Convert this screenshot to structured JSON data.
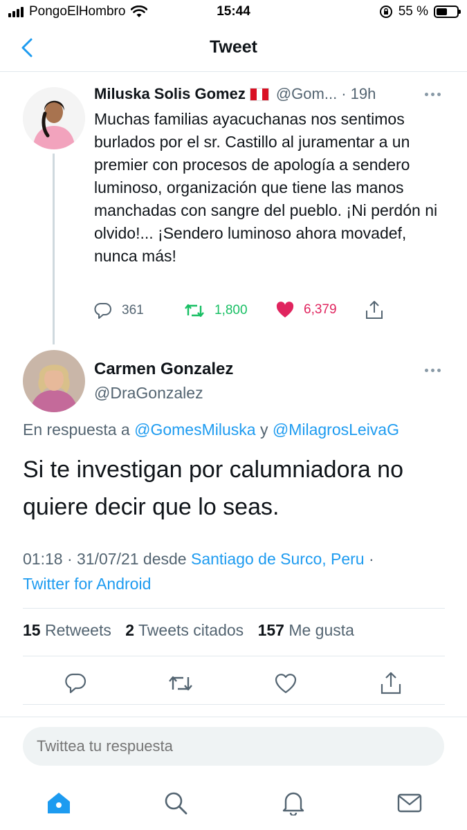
{
  "status": {
    "carrier": "PongoElHombro",
    "time": "15:44",
    "battery": "55 %",
    "battery_level": 0.55
  },
  "nav": {
    "title": "Tweet",
    "back_icon": "chevron-left-icon"
  },
  "parent_tweet": {
    "name": "Miluska Solis Gomez",
    "flag": "peru-flag",
    "handle": "@Gom...",
    "time": "· 19h",
    "text": "Muchas familias ayacuchanas  nos sentimos  burlados por el sr. Castillo al juramentar a un premier con procesos de apología a sendero luminoso, organización que tiene las manos manchadas con sangre del pueblo. ¡Ni perdón ni olvido!... ¡Sendero luminoso ahora movadef, nunca más!",
    "replies": "361",
    "retweets": "1,800",
    "likes": "6,379",
    "colors": {
      "retweet": "#17bf63",
      "like": "#e0245e"
    }
  },
  "main_tweet": {
    "name": "Carmen Gonzalez",
    "handle": "@DraGonzalez",
    "reply_prefix": "En respuesta a ",
    "reply_user1": "@GomesMiluska",
    "reply_sep": " y ",
    "reply_user2": "@MilagrosLeivaG",
    "text": "Si te investigan por calumniadora no quiere decir que lo seas.",
    "timestamp": "01:18 · 31/07/21 desde ",
    "location": "Santiago de Surco, Peru",
    "meta_sep": " ·",
    "source": "Twitter for Android",
    "retweets_count": "15",
    "retweets_label": "Retweets",
    "quotes_count": "2",
    "quotes_label": "Tweets citados",
    "likes_count": "157",
    "likes_label": "Me gusta"
  },
  "reply": {
    "placeholder": "Twittea tu respuesta"
  },
  "tabbar": {
    "items": [
      "home-icon",
      "search-icon",
      "bell-icon",
      "mail-icon"
    ],
    "accent": "#1d9bf0"
  }
}
